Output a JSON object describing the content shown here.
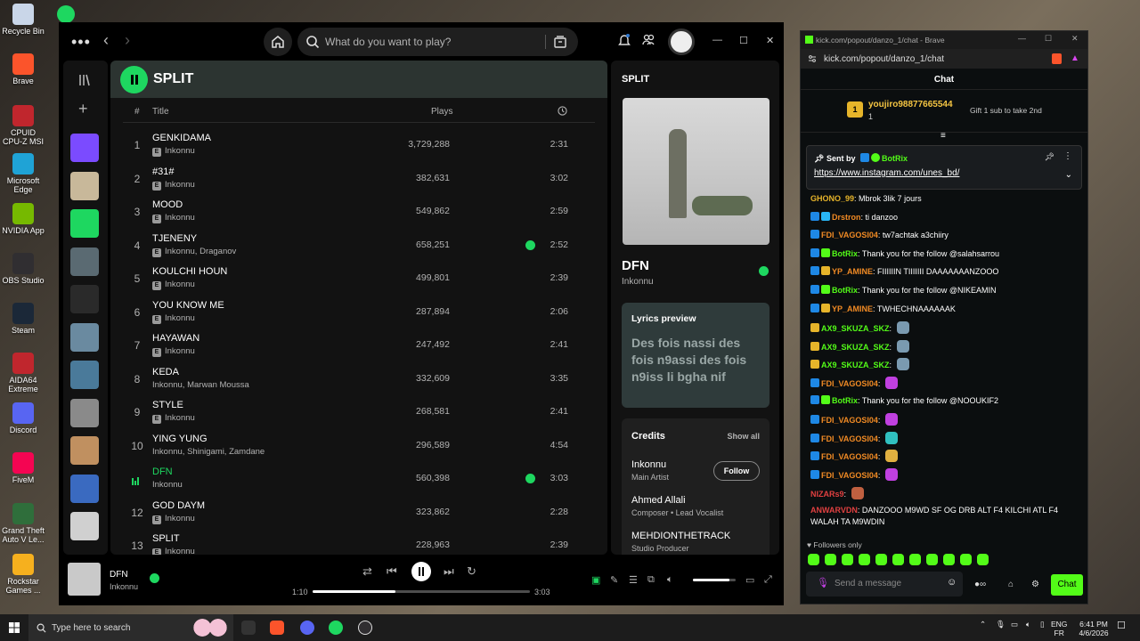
{
  "desktop": {
    "icons": [
      {
        "label": "Recycle Bin",
        "color": "#c9d6e8"
      },
      {
        "label": "Brave",
        "color": "#fb542b"
      },
      {
        "label": "CPUID CPU-Z MSI",
        "color": "#c0262d"
      },
      {
        "label": "Microsoft Edge",
        "color": "#1fa3d6"
      },
      {
        "label": "NVIDIA App",
        "color": "#76b900"
      },
      {
        "label": "OBS Studio",
        "color": "#302e31"
      },
      {
        "label": "Steam",
        "color": "#1b2838"
      },
      {
        "label": "AIDA64 Extreme",
        "color": "#c0262d"
      },
      {
        "label": "Discord",
        "color": "#5865f2"
      },
      {
        "label": "FiveM",
        "color": "#f40552"
      },
      {
        "label": "Grand Theft Auto V Le...",
        "color": "#2f6e3b"
      },
      {
        "label": "Rockstar Games ...",
        "color": "#f6b01e"
      }
    ],
    "spotify_shortcut_label": "S"
  },
  "spotify": {
    "search_placeholder": "What do you want to play?",
    "window_controls": {
      "minimize": "—",
      "maximize": "☐",
      "close": "✕"
    },
    "playlist_title": "SPLIT",
    "columns": {
      "num": "#",
      "title": "Title",
      "plays": "Plays"
    },
    "tracks": [
      {
        "num": "1",
        "title": "GENKIDAMA",
        "artist": "Inkonnu",
        "plays": "3,729,288",
        "duration": "2:31",
        "explicit": "E",
        "saved": false,
        "active": false
      },
      {
        "num": "2",
        "title": "#31#",
        "artist": "Inkonnu",
        "plays": "382,631",
        "duration": "3:02",
        "explicit": "E",
        "saved": false,
        "active": false
      },
      {
        "num": "3",
        "title": "MOOD",
        "artist": "Inkonnu",
        "plays": "549,862",
        "duration": "2:59",
        "explicit": "E",
        "saved": false,
        "active": false
      },
      {
        "num": "4",
        "title": "TJENENY",
        "artist": "Inkonnu, Draganov",
        "plays": "658,251",
        "duration": "2:52",
        "explicit": "E",
        "saved": true,
        "active": false
      },
      {
        "num": "5",
        "title": "KOULCHI HOUN",
        "artist": "Inkonnu",
        "plays": "499,801",
        "duration": "2:39",
        "explicit": "E",
        "saved": false,
        "active": false
      },
      {
        "num": "6",
        "title": "YOU KNOW ME",
        "artist": "Inkonnu",
        "plays": "287,894",
        "duration": "2:06",
        "explicit": "E",
        "saved": false,
        "active": false
      },
      {
        "num": "7",
        "title": "HAYAWAN",
        "artist": "Inkonnu",
        "plays": "247,492",
        "duration": "2:41",
        "explicit": "E",
        "saved": false,
        "active": false
      },
      {
        "num": "8",
        "title": "KEDA",
        "artist": "Inkonnu, Marwan Moussa",
        "plays": "332,609",
        "duration": "3:35",
        "explicit": "",
        "saved": false,
        "active": false
      },
      {
        "num": "9",
        "title": "STYLE",
        "artist": "Inkonnu",
        "plays": "268,581",
        "duration": "2:41",
        "explicit": "E",
        "saved": false,
        "active": false
      },
      {
        "num": "10",
        "title": "YING YUNG",
        "artist": "Inkonnu, Shinigami, Zamdane",
        "plays": "296,589",
        "duration": "4:54",
        "explicit": "",
        "saved": false,
        "active": false
      },
      {
        "num": "",
        "title": "DFN",
        "artist": "Inkonnu",
        "plays": "560,398",
        "duration": "3:03",
        "explicit": "",
        "saved": true,
        "active": true
      },
      {
        "num": "12",
        "title": "GOD DAYM",
        "artist": "Inkonnu",
        "plays": "323,862",
        "duration": "2:28",
        "explicit": "E",
        "saved": false,
        "active": false
      },
      {
        "num": "13",
        "title": "SPLIT",
        "artist": "Inkonnu",
        "plays": "228,963",
        "duration": "2:39",
        "explicit": "E",
        "saved": false,
        "active": false
      }
    ],
    "right_panel": {
      "title": "SPLIT",
      "song": "DFN",
      "artist": "Inkonnu",
      "lyrics_heading": "Lyrics preview",
      "lyrics_text": "Des fois nassi des fois n9assi des fois n9iss li bgha nif",
      "credits_heading": "Credits",
      "show_all": "Show all",
      "follow": "Follow",
      "credits": [
        {
          "name": "Inkonnu",
          "role": "Main Artist"
        },
        {
          "name": "Ahmed Allali",
          "role": "Composer • Lead Vocalist"
        },
        {
          "name": "MEHDIONTHETRACK",
          "role": "Studio Producer"
        }
      ]
    },
    "now_playing": {
      "title": "DFN",
      "artist": "Inkonnu",
      "elapsed": "1:10",
      "total": "3:03",
      "progress_fraction": 0.38,
      "volume_fraction": 0.85
    },
    "library_thumb_colors": [
      "#7b4bff",
      "#c8b89a",
      "#1ed760",
      "#5a6a72",
      "#2a2a2a",
      "#6a8aa0",
      "#4a7a9a",
      "#8a8a8a",
      "#c09060",
      "#3a6ac0",
      "#d0d0d0"
    ]
  },
  "kick": {
    "window_title": "kick.com/popout/danzo_1/chat - Brave",
    "url": "kick.com/popout/danzo_1/chat",
    "chat_header": "Chat",
    "gift": {
      "rank": "1",
      "user": "youjiro98877665544",
      "count": "1",
      "cta": "Gift 1 sub to take 2nd"
    },
    "pinned": {
      "sent_by": "Sent by",
      "sender": "BotRix",
      "link": "https://www.instagram.com/unes_bd/"
    },
    "messages": [
      {
        "user": "GHONO_99",
        "text": "Mbrok 3lik 7 jours",
        "color": "#e6b42a",
        "badges": [],
        "emote": ""
      },
      {
        "user": "Drstron",
        "text": "ti danzoo",
        "color": "#f08a24",
        "badges": [
          "#1e88e5",
          "#29b6f6"
        ],
        "emote": ""
      },
      {
        "user": "FDI_VAGOSI04",
        "text": "tw7achtak a3chiiry",
        "color": "#f08a24",
        "badges": [
          "#1e88e5"
        ],
        "emote": ""
      },
      {
        "user": "BotRix",
        "text": "Thank you for the follow @salahsarrou",
        "color": "#53fc18",
        "badges": [
          "#1e88e5",
          "#53fc18"
        ],
        "emote": ""
      },
      {
        "user": "YP_AMINE",
        "text": "FIIIIIIN TIIIIIII DAAAAAAANZOOO",
        "color": "#f08a24",
        "badges": [
          "#1e88e5",
          "#e6b42a"
        ],
        "emote": ""
      },
      {
        "user": "BotRix",
        "text": "Thank you for the follow @NIKEAMIN",
        "color": "#53fc18",
        "badges": [
          "#1e88e5",
          "#53fc18"
        ],
        "emote": ""
      },
      {
        "user": "YP_AMINE",
        "text": "TWHECHNAAAAAAK",
        "color": "#f08a24",
        "badges": [
          "#1e88e5",
          "#e6b42a"
        ],
        "emote": ""
      },
      {
        "user": "AX9_SKUZA_SKZ",
        "text": "",
        "color": "#53fc18",
        "badges": [
          "#e6b42a"
        ],
        "emote": "#7a9ab0"
      },
      {
        "user": "AX9_SKUZA_SKZ",
        "text": "",
        "color": "#53fc18",
        "badges": [
          "#e6b42a"
        ],
        "emote": "#7a9ab0"
      },
      {
        "user": "AX9_SKUZA_SKZ",
        "text": "",
        "color": "#53fc18",
        "badges": [
          "#e6b42a"
        ],
        "emote": "#7a9ab0"
      },
      {
        "user": "FDI_VAGOSI04",
        "text": "",
        "color": "#f08a24",
        "badges": [
          "#1e88e5"
        ],
        "emote": "#c040e0"
      },
      {
        "user": "BotRix",
        "text": "Thank you for the follow @NOOUKIF2",
        "color": "#53fc18",
        "badges": [
          "#1e88e5",
          "#53fc18"
        ],
        "emote": ""
      },
      {
        "user": "FDI_VAGOSI04",
        "text": "",
        "color": "#f08a24",
        "badges": [
          "#1e88e5"
        ],
        "emote": "#c040e0"
      },
      {
        "user": "FDI_VAGOSI04",
        "text": "",
        "color": "#f08a24",
        "badges": [
          "#1e88e5"
        ],
        "emote": "#30c0c0"
      },
      {
        "user": "FDI_VAGOSI04",
        "text": "",
        "color": "#f08a24",
        "badges": [
          "#1e88e5"
        ],
        "emote": "#e0b040"
      },
      {
        "user": "FDI_VAGOSI04",
        "text": "",
        "color": "#f08a24",
        "badges": [
          "#1e88e5"
        ],
        "emote": "#c040e0"
      },
      {
        "user": "NIZARs9",
        "text": "",
        "color": "#e04040",
        "badges": [],
        "emote": "#c06040"
      },
      {
        "user": "ANWARVDN",
        "text": "DANZOOO M9WD SF OG DRB ALT F4 KILCHI ATL F4 WALAH TA M9WDIN",
        "color": "#e04040",
        "badges": [],
        "emote": ""
      }
    ],
    "followers_only": "Followers only",
    "input_placeholder": "Send a message",
    "chat_button": "Chat"
  },
  "taskbar": {
    "search_placeholder": "Type here to search",
    "lang": "ENG",
    "region": "FR",
    "time": "6:41 PM",
    "date": "4/6/2026"
  },
  "colors": {
    "accent": "#1ed760",
    "kick_green": "#53fc18"
  }
}
